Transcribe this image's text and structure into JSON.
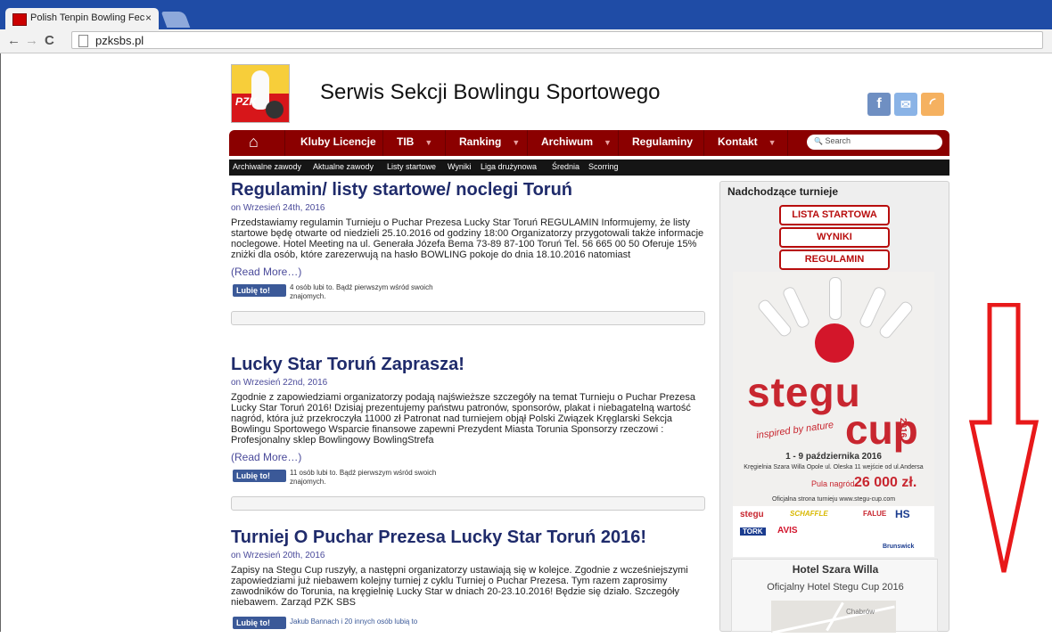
{
  "browser": {
    "tab_title": "Polish Tenpin Bowling Fec",
    "tab_close": "×",
    "nav_back": "←",
    "nav_forward": "→",
    "nav_reload": "C",
    "url": "pzksbs.pl"
  },
  "header": {
    "logo_text": "PZK",
    "site_title": "Serwis Sekcji Bowlingu Sportowego",
    "social": {
      "facebook": "f",
      "email": "✉",
      "rss": "◜"
    }
  },
  "menu": {
    "home_icon": "⌂",
    "items": [
      {
        "label": "Kluby Licencje",
        "caret": ""
      },
      {
        "label": "TIB",
        "caret": "▼"
      },
      {
        "label": "Ranking",
        "caret": "▼"
      },
      {
        "label": "Archiwum",
        "caret": "▼"
      },
      {
        "label": "Regulaminy",
        "caret": ""
      },
      {
        "label": "Kontakt",
        "caret": "▼"
      }
    ],
    "search_placeholder": "Search",
    "search_icon": "🔍"
  },
  "submenu": [
    "Archiwalne zawody",
    "Aktualne zawody",
    "Listy startowe",
    "Wyniki",
    "Liga drużynowa",
    "Średnia",
    "Scorring"
  ],
  "posts": [
    {
      "title": "Regulamin/ listy startowe/ noclegi Toruń",
      "date": "on Wrzesień 24th, 2016",
      "body": "Przedstawiamy regulamin Turnieju o Puchar Prezesa Lucky Star Toruń REGULAMIN Informujemy, że listy startowe będę otwarte od niedzieli 25.10.2016 od godziny 18:00 Organizatorzy przygotowali także informacje noclegowe. Hotel Meeting na ul. Generała Józefa Bema 73-89 87-100 Toruń  Tel. 56 665 00 50 Oferuje 15% zniżki dla osób, które zarezerwują na hasło BOWLING pokoje do dnia 18.10.2016 natomiast",
      "read_more": "(Read More…)",
      "like_label": "Lubię to!",
      "like_text": "4 osób lubi to. Bądź pierwszym wśród swoich znajomych."
    },
    {
      "title": "Lucky Star Toruń Zaprasza!",
      "date": "on Wrzesień 22nd, 2016",
      "body": "Zgodnie z zapowiedziami organizatorzy podają najświeższe szczegóły na temat Turnieju o Puchar Prezesa Lucky Star Toruń 2016! Dzisiaj prezentujemy państwu patronów, sponsorów, plakat i niebagatelną wartość nagród, która już przekroczyła 11000 zł Patronat nad turniejem objął Polski Związek Kręglarski Sekcja Bowlingu Sportowego Wsparcie finansowe zapewni Prezydent Miasta Torunia Sponsorzy rzeczowi : Profesjonalny sklep Bowlingowy BowlingStrefa",
      "read_more": "(Read More…)",
      "like_label": "Lubię to!",
      "like_text": "11 osób lubi to. Bądź pierwszym wśród swoich znajomych."
    },
    {
      "title": "Turniej O Puchar Prezesa Lucky Star Toruń 2016!",
      "date": "on Wrzesień 20th, 2016",
      "body": "Zapisy na Stegu Cup ruszyły, a następni organizatorzy ustawiają się w kolejce. Zgodnie z wcześniejszymi zapowiedziami już niebawem kolejny turniej z cyklu Turniej o Puchar Prezesa. Tym razem zaprosimy zawodników do Torunia, na kręgielnię Lucky Star w dniach 20-23.10.2016! Będzie się działo. Szczegóły niebawem. Zarząd PZK SBS",
      "like_label": "Lubię to!",
      "like_text": "Jakub Bannach i 20 innych osób lubią to"
    }
  ],
  "sidebar": {
    "heading": "Nadchodzące turnieje",
    "buttons": [
      "LISTA STARTOWA",
      "WYNIKI",
      "REGULAMIN"
    ],
    "poster": {
      "title_1": "stegu",
      "title_2": "cup",
      "year": "2016",
      "tagline": "inspired by nature",
      "dates": "1 - 9 października 2016",
      "venue": "Kręgielnia Szara Willa Opole ul. Oleska 11 wejście od ul.Andersa",
      "prize_label": "Pula nagród",
      "prize_amount": "26 000 zł.",
      "site": "Oficjalna strona turnieju www.stegu-cup.com",
      "sponsors": [
        "stegu",
        "SCHAFFLE",
        "FALUE",
        "HS",
        "TORK",
        "AVIS",
        "Brunswick"
      ]
    },
    "hotel_title": "Hotel Szara Willa",
    "hotel_subtitle": "Oficjalny Hotel Stegu Cup 2016",
    "map_label": "Chabrów"
  },
  "colors": {
    "menu_bg": "#8b0000",
    "post_title": "#1f2b6b",
    "accent_red": "#b80d0d",
    "arrow_red": "#e8191a"
  }
}
